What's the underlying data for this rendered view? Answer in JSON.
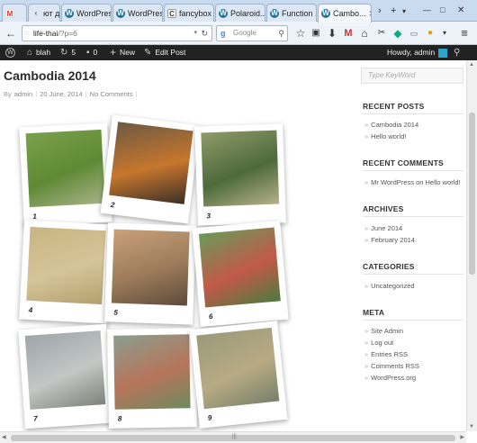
{
  "tabs": [
    {
      "label": "",
      "favicon": "gmail-icon"
    },
    {
      "label": "ют д...",
      "favicon": "arrow-left-icon"
    },
    {
      "label": "WordPres...",
      "favicon": "wordpress-icon"
    },
    {
      "label": "WordPres...",
      "favicon": "wordpress-icon"
    },
    {
      "label": "fancybox ...",
      "favicon": "c-icon"
    },
    {
      "label": "Polaroid...",
      "favicon": "wordpress-icon"
    },
    {
      "label": "Function ...",
      "favicon": "wordpress-icon"
    },
    {
      "label": "Cambo...",
      "favicon": "wordpress-icon"
    }
  ],
  "browser": {
    "url_host": "life-thai",
    "url_path": "/?p=6",
    "search_placeholder": "Google"
  },
  "adminbar": {
    "site_name": "blah",
    "updates_count": "5",
    "comments_count": "0",
    "new_label": "New",
    "edit_label": "Edit Post",
    "howdy": "Howdy, admin"
  },
  "post": {
    "title": "Cambodia 2014",
    "by": "By",
    "author": "admin",
    "date": "20 June, 2014",
    "comments": "No Comments"
  },
  "photos": [
    {
      "label": "1",
      "colors": [
        "#7aa04a",
        "#5f8a35",
        "#a8b38a"
      ]
    },
    {
      "label": "2",
      "colors": [
        "#6b5a42",
        "#c7762d",
        "#3a2f26"
      ]
    },
    {
      "label": "3",
      "colors": [
        "#8f9a6a",
        "#4d6a3a",
        "#b6b08a"
      ]
    },
    {
      "label": "4",
      "colors": [
        "#c8b585",
        "#d5c497",
        "#b3a070"
      ]
    },
    {
      "label": "5",
      "colors": [
        "#c9a17a",
        "#9c7b5a",
        "#5b4a3a"
      ]
    },
    {
      "label": "6",
      "colors": [
        "#6a9a5a",
        "#c25a48",
        "#4d7a40"
      ]
    },
    {
      "label": "7",
      "colors": [
        "#9fa6a8",
        "#c3c8c6",
        "#7d8279"
      ]
    },
    {
      "label": "8",
      "colors": [
        "#8c9e8f",
        "#b6745a",
        "#6e8a5e"
      ]
    },
    {
      "label": "9",
      "colors": [
        "#9a9a7a",
        "#b8ab84",
        "#77806a"
      ]
    }
  ],
  "sidebar": {
    "search_placeholder": "Type KeyWord",
    "recent_posts_title": "RECENT POSTS",
    "recent_posts": [
      "Cambodia 2014",
      "Hello world!"
    ],
    "recent_comments_title": "RECENT COMMENTS",
    "recent_comment": {
      "author": "Mr WordPress",
      "on": "on",
      "post": "Hello world!"
    },
    "archives_title": "ARCHIVES",
    "archives": [
      "June 2014",
      "February 2014"
    ],
    "categories_title": "CATEGORIES",
    "categories": [
      "Uncategorized"
    ],
    "meta_title": "META",
    "meta": [
      "Site Admin",
      "Log out",
      "Entries RSS",
      "Comments RSS",
      "WordPress.org"
    ]
  },
  "colors": {
    "tab_strip": "#c9dbef",
    "admin_bar": "#222222",
    "wp_blue": "#21759b"
  }
}
